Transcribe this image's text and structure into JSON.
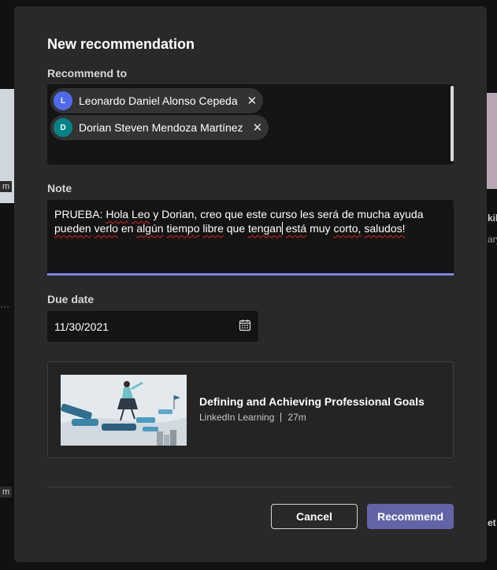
{
  "dialog": {
    "title": "New recommendation",
    "recommend_to_label": "Recommend to",
    "recipients": [
      {
        "initial": "L",
        "name": "Leonardo Daniel Alonso Cepeda",
        "color": "#4f6bed"
      },
      {
        "initial": "D",
        "name": "Dorian Steven Mendoza Martínez",
        "color": "#038387"
      }
    ],
    "note_label": "Note",
    "note": {
      "prefix": "PRUEBA: ",
      "w1": "Hola",
      "w2": "Leo",
      "s1": " y Dorian, creo que este curso les será de mucha ayuda",
      "w3": "pueden",
      "s2": " ",
      "w4": "verlo",
      "s3": " en ",
      "w5": "algún",
      "s4": " ",
      "w6": "tiempo",
      "s5": " ",
      "w7": "libre",
      "s6": " que ",
      "w8": "tengan",
      "s7": " ",
      "w9": "está",
      "s8": " muy ",
      "w10": "corto,",
      "s9": " ",
      "w11": "saludos!"
    },
    "due_date_label": "Due date",
    "due_date": "11/30/2021",
    "course": {
      "title": "Defining and Achieving Professional Goals",
      "provider": "LinkedIn Learning",
      "duration": "27m"
    },
    "cancel_label": "Cancel",
    "recommend_label": "Recommend"
  },
  "background": {
    "tag_top": "m",
    "tag_bottom": "m",
    "dots": "···",
    "partial_right_1": "kil",
    "partial_right_2": "ary",
    "partial_right_3": "et"
  },
  "colors": {
    "accent": "#6264a7",
    "focus_underline": "#7f85f5",
    "modal_bg": "#292929",
    "field_bg": "#141414"
  },
  "icons": {
    "remove": "close-icon",
    "calendar": "calendar-icon"
  }
}
